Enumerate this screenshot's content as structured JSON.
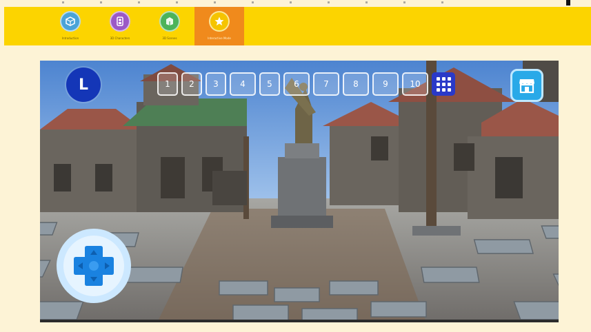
{
  "toolbar": {
    "tabs": [
      {
        "label": "Introduction",
        "icon": "cube-icon",
        "color": "#4aa3d8"
      },
      {
        "label": "3D Characters",
        "icon": "character-icon",
        "color": "#9b59c6"
      },
      {
        "label": "3D Scenes",
        "icon": "scene-icon",
        "color": "#4cb35a"
      },
      {
        "label": "Interactive Mode",
        "icon": "star-icon",
        "color": "#f5c400",
        "active": true
      }
    ]
  },
  "hud": {
    "player_badge": "L",
    "slots": [
      "1",
      "2",
      "3",
      "4",
      "5",
      "6",
      "7",
      "8",
      "9",
      "10"
    ],
    "grid_button_icon": "grid-icon",
    "store_button_icon": "store-icon",
    "dpad_icon": "dpad-icon"
  },
  "colors": {
    "toolbar_bg": "#fcd400",
    "active_tab": "#f08a1c",
    "page_bg": "#fdf3d6",
    "badge": "#1436b7",
    "store": "#29a9e8",
    "dpad": "#1a82e0"
  }
}
